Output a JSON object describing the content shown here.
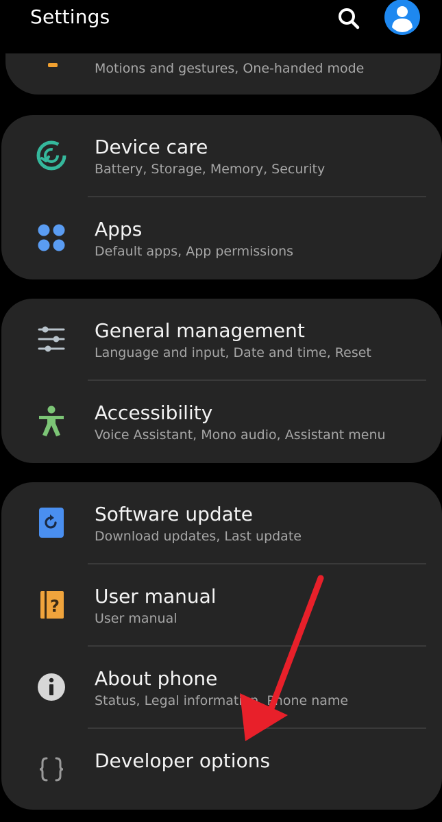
{
  "header": {
    "title": "Settings",
    "search_icon": "search-icon",
    "avatar_icon": "account-icon"
  },
  "partial_item": {
    "subtitle": "Motions and gestures, One-handed mode"
  },
  "groups": [
    {
      "items": [
        {
          "title": "Device care",
          "subtitle": "Battery, Storage, Memory, Security",
          "icon": "device-care-icon",
          "color": "#35b89c"
        },
        {
          "title": "Apps",
          "subtitle": "Default apps, App permissions",
          "icon": "apps-icon",
          "color": "#5a9cf2"
        }
      ]
    },
    {
      "items": [
        {
          "title": "General management",
          "subtitle": "Language and input, Date and time, Reset",
          "icon": "sliders-icon",
          "color": "#b9c4cc"
        },
        {
          "title": "Accessibility",
          "subtitle": "Voice Assistant, Mono audio, Assistant menu",
          "icon": "accessibility-icon",
          "color": "#7cc576"
        }
      ]
    },
    {
      "items": [
        {
          "title": "Software update",
          "subtitle": "Download updates, Last update",
          "icon": "software-update-icon",
          "color": "#4a8ff0"
        },
        {
          "title": "User manual",
          "subtitle": "User manual",
          "icon": "user-manual-icon",
          "color": "#f0a43c"
        },
        {
          "title": "About phone",
          "subtitle": "Status, Legal information, Phone name",
          "icon": "info-icon",
          "color": "#d7d7d7"
        },
        {
          "title": "Developer options",
          "subtitle": "",
          "icon": "braces-icon",
          "color": "#9a9a9a"
        }
      ]
    }
  ],
  "annotation": {
    "arrow_color": "#e8202a"
  }
}
